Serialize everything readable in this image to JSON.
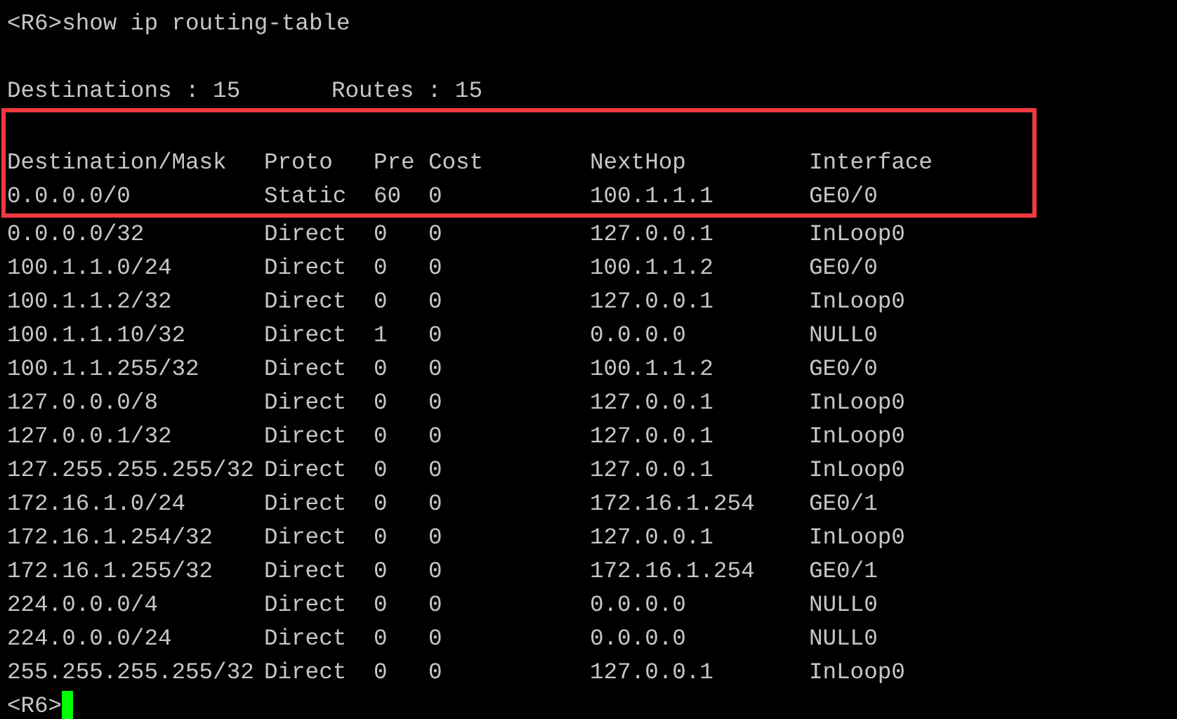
{
  "command": "<R6>show ip routing-table",
  "summary": {
    "destinations": "Destinations : 15",
    "routes": "Routes : 15"
  },
  "table": {
    "columns": [
      "Destination/Mask",
      "Proto",
      "Pre",
      "Cost",
      "NextHop",
      "Interface"
    ],
    "rows": [
      {
        "cells": [
          "0.0.0.0/0",
          "Static",
          "60",
          "0",
          "100.1.1.1",
          "GE0/0"
        ],
        "highlighted": true
      },
      {
        "cells": [
          "0.0.0.0/32",
          "Direct",
          "0",
          "0",
          "127.0.0.1",
          "InLoop0"
        ],
        "highlighted": false
      },
      {
        "cells": [
          "100.1.1.0/24",
          "Direct",
          "0",
          "0",
          "100.1.1.2",
          "GE0/0"
        ],
        "highlighted": false
      },
      {
        "cells": [
          "100.1.1.2/32",
          "Direct",
          "0",
          "0",
          "127.0.0.1",
          "InLoop0"
        ],
        "highlighted": false
      },
      {
        "cells": [
          "100.1.1.10/32",
          "Direct",
          "1",
          "0",
          "0.0.0.0",
          "NULL0"
        ],
        "highlighted": false
      },
      {
        "cells": [
          "100.1.1.255/32",
          "Direct",
          "0",
          "0",
          "100.1.1.2",
          "GE0/0"
        ],
        "highlighted": false
      },
      {
        "cells": [
          "127.0.0.0/8",
          "Direct",
          "0",
          "0",
          "127.0.0.1",
          "InLoop0"
        ],
        "highlighted": false
      },
      {
        "cells": [
          "127.0.0.1/32",
          "Direct",
          "0",
          "0",
          "127.0.0.1",
          "InLoop0"
        ],
        "highlighted": false
      },
      {
        "cells": [
          "127.255.255.255/32",
          "Direct",
          "0",
          "0",
          "127.0.0.1",
          "InLoop0"
        ],
        "highlighted": false
      },
      {
        "cells": [
          "172.16.1.0/24",
          "Direct",
          "0",
          "0",
          "172.16.1.254",
          "GE0/1"
        ],
        "highlighted": false
      },
      {
        "cells": [
          "172.16.1.254/32",
          "Direct",
          "0",
          "0",
          "127.0.0.1",
          "InLoop0"
        ],
        "highlighted": false
      },
      {
        "cells": [
          "172.16.1.255/32",
          "Direct",
          "0",
          "0",
          "172.16.1.254",
          "GE0/1"
        ],
        "highlighted": false
      },
      {
        "cells": [
          "224.0.0.0/4",
          "Direct",
          "0",
          "0",
          "0.0.0.0",
          "NULL0"
        ],
        "highlighted": false
      },
      {
        "cells": [
          "224.0.0.0/24",
          "Direct",
          "0",
          "0",
          "0.0.0.0",
          "NULL0"
        ],
        "highlighted": false
      },
      {
        "cells": [
          "255.255.255.255/32",
          "Direct",
          "0",
          "0",
          "127.0.0.1",
          "InLoop0"
        ],
        "highlighted": false
      }
    ]
  },
  "prompt": "<R6>"
}
